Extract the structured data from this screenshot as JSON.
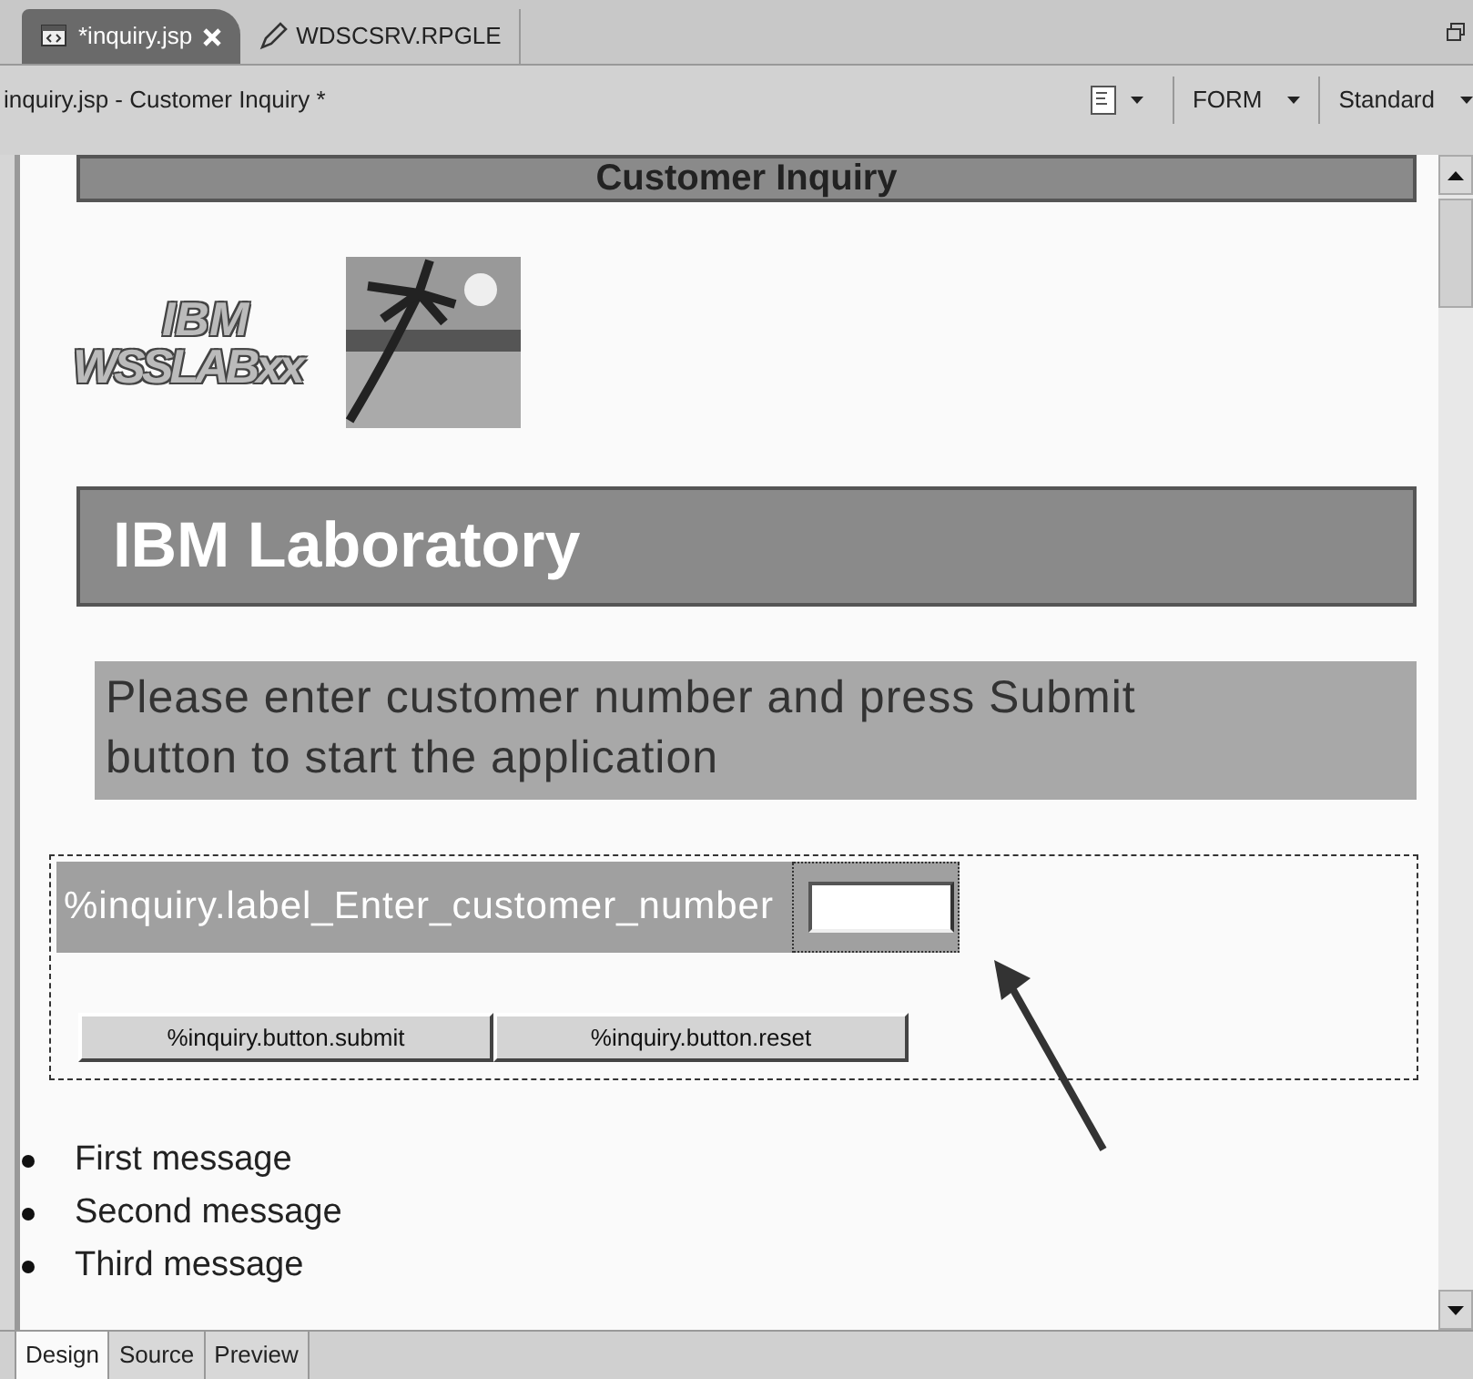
{
  "editor_tabs": [
    {
      "label": "*inquiry.jsp",
      "kind": "jsp",
      "selected": true,
      "closable": true
    },
    {
      "label": "WDSCSRV.RPGLE",
      "kind": "rpgle",
      "selected": false,
      "closable": false
    }
  ],
  "title_bar": {
    "title": "inquiry.jsp - Customer Inquiry *",
    "dropdowns": [
      "FORM",
      "Standard"
    ]
  },
  "page": {
    "top_banner": "Customer Inquiry",
    "logo": {
      "line_1": "IBM",
      "line_2": "WSSLABxx"
    },
    "heading": "IBM Laboratory",
    "instructions": "Please enter customer number and press Submit button to start the application",
    "form": {
      "label": "%inquiry.label_Enter_customer_number",
      "buttons": [
        "%inquiry.button.submit",
        "%inquiry.button.reset"
      ]
    },
    "messages": [
      "First message",
      "Second message",
      "Third message"
    ]
  },
  "view_tabs": [
    {
      "label": "Design",
      "selected": true
    },
    {
      "label": "Source",
      "selected": false
    },
    {
      "label": "Preview",
      "selected": false
    }
  ]
}
